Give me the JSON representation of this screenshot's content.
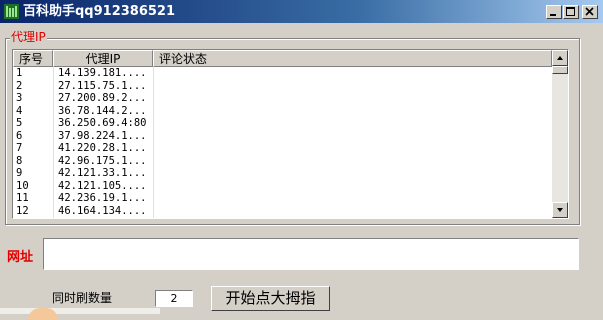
{
  "window": {
    "title": "百科助手qq912386521",
    "controls": [
      "minimize",
      "maximize",
      "close"
    ]
  },
  "proxy_group": {
    "label": "代理IP",
    "columns": [
      "序号",
      "代理IP",
      "评论状态"
    ],
    "rows": [
      {
        "index": "1",
        "ip": "14.139.181....",
        "status": ""
      },
      {
        "index": "2",
        "ip": "27.115.75.1...",
        "status": ""
      },
      {
        "index": "3",
        "ip": "27.200.89.2...",
        "status": ""
      },
      {
        "index": "4",
        "ip": "36.78.144.2...",
        "status": ""
      },
      {
        "index": "5",
        "ip": "36.250.69.4:80",
        "status": ""
      },
      {
        "index": "6",
        "ip": "37.98.224.1...",
        "status": ""
      },
      {
        "index": "7",
        "ip": "41.220.28.1...",
        "status": ""
      },
      {
        "index": "8",
        "ip": "42.96.175.1...",
        "status": ""
      },
      {
        "index": "9",
        "ip": "42.121.33.1...",
        "status": ""
      },
      {
        "index": "10",
        "ip": "42.121.105....",
        "status": ""
      },
      {
        "index": "11",
        "ip": "42.236.19.1...",
        "status": ""
      },
      {
        "index": "12",
        "ip": "46.164.134....",
        "status": ""
      }
    ]
  },
  "url": {
    "label": "网址",
    "value": ""
  },
  "concurrency": {
    "label": "同时刷数量",
    "value": "2"
  },
  "start_button": {
    "label": "开始点大拇指"
  },
  "colors": {
    "titlebar_start": "#0a246a",
    "titlebar_end": "#a6caf0",
    "label_red": "#e00000",
    "face": "#d4d0c8"
  },
  "icons": {
    "app": "app-logo-icon",
    "minimize": "minimize-icon",
    "maximize": "maximize-icon",
    "close": "close-icon",
    "scroll_up": "arrow-up-icon",
    "scroll_down": "arrow-down-icon"
  }
}
